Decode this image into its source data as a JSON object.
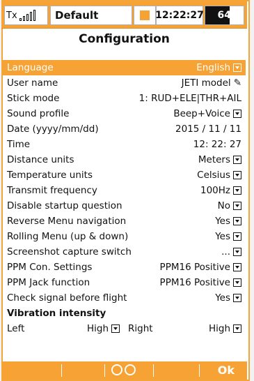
{
  "statusbar": {
    "tx_label": "Tx",
    "model": "Default",
    "time": "12:22:27",
    "battery": "64%",
    "battery_level": 0.64,
    "accent": "#f6a234"
  },
  "page_title": "Configuration",
  "rows": [
    {
      "label": "Language",
      "value": "English",
      "dropdown": true,
      "selected": true
    },
    {
      "label": "User name",
      "value": "JETI model",
      "edit_icon": true
    },
    {
      "label": "Stick mode",
      "value": "1: RUD+ELE|THR+AIL"
    },
    {
      "label": "Sound profile",
      "value": "Beep+Voice",
      "dropdown": true
    },
    {
      "label": "Date (yyyy/mm/dd)",
      "value": "2015 / 11 / 11"
    },
    {
      "label": "Time",
      "value": "12: 22: 27"
    },
    {
      "label": "Distance units",
      "value": "Meters",
      "dropdown": true
    },
    {
      "label": "Temperature units",
      "value": "Celsius",
      "dropdown": true
    },
    {
      "label": "Transmit frequency",
      "value": "100Hz",
      "dropdown": true
    },
    {
      "label": "Disable startup question",
      "value": "No",
      "dropdown": true
    },
    {
      "label": "Reverse Menu navigation",
      "value": "Yes",
      "dropdown": true
    },
    {
      "label": "Rolling Menu (up & down)",
      "value": "Yes",
      "dropdown": true
    },
    {
      "label": "Screenshot capture switch",
      "value": "...",
      "dropdown": true
    },
    {
      "label": "PPM Con. Settings",
      "value": "PPM16 Positive",
      "dropdown": true
    },
    {
      "label": "PPM Jack function",
      "value": "PPM16 Positive",
      "dropdown": true
    },
    {
      "label": "Check signal before flight",
      "value": "Yes",
      "dropdown": true
    }
  ],
  "vibration": {
    "heading": "Vibration intensity",
    "left_label": "Left",
    "left_value": "High",
    "right_label": "Right",
    "right_value": "High"
  },
  "bottombar": {
    "ok_label": "Ok"
  }
}
